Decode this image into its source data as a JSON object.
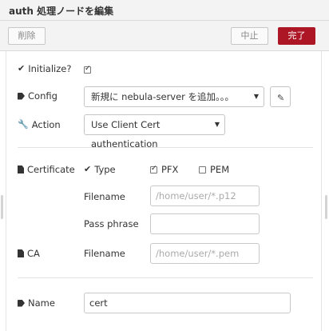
{
  "window": {
    "title": "auth 処理ノードを編集"
  },
  "toolbar": {
    "delete_label": "削除",
    "cancel_label": "中止",
    "done_label": "完了"
  },
  "form": {
    "initialize": {
      "label": "Initialize?",
      "checked": true
    },
    "config": {
      "label": "Config",
      "value": "新規に nebula-server を追加。。。"
    },
    "action": {
      "label": "Action",
      "value": "Use Client Cert authentication"
    },
    "certificate": {
      "label": "Certificate",
      "type_label": "Type",
      "pfx_label": "PFX",
      "pfx_checked": true,
      "pem_label": "PEM",
      "pem_checked": false,
      "filename_label": "Filename",
      "filename_placeholder": "/home/user/*.p12",
      "passphrase_label": "Pass phrase",
      "passphrase_value": ""
    },
    "ca": {
      "label": "CA",
      "filename_label": "Filename",
      "filename_placeholder": "/home/user/*.pem"
    },
    "name": {
      "label": "Name",
      "value": "cert"
    }
  },
  "colors": {
    "done_button": "#ad1625",
    "header_bg": "#f3f3f3"
  },
  "icons": [
    "check-icon",
    "tag-icon",
    "wrench-icon",
    "file-icon",
    "pencil-icon",
    "caret-down-icon"
  ]
}
